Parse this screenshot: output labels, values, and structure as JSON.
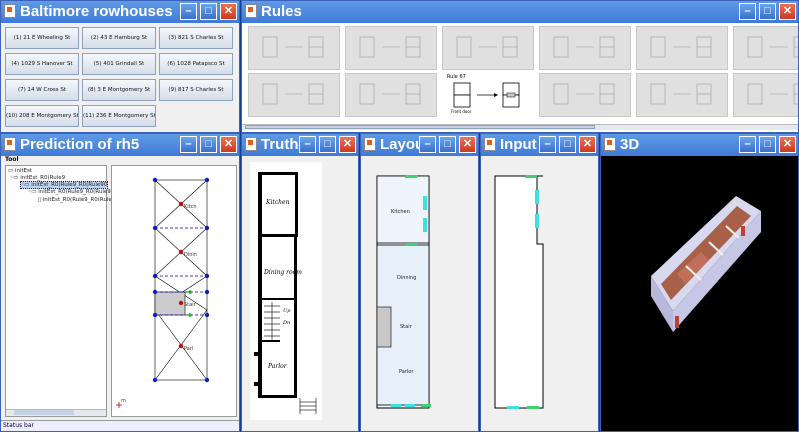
{
  "windows": {
    "baltimore": {
      "title": "Baltimore rowhouses"
    },
    "rules": {
      "title": "Rules"
    },
    "prediction": {
      "title": "Prediction of rh5",
      "menu": "Tool",
      "status": "Status bar"
    },
    "truth": {
      "title": "Truth"
    },
    "layout": {
      "title": "Layout"
    },
    "input": {
      "title": "Input"
    },
    "threed": {
      "title": "3D"
    }
  },
  "rowhouses": [
    "(1) 21 E Wheeling St",
    "(2) 43 E Hamburg St",
    "(3) 821 S Charles St",
    "(4) 1029 S Hanover St",
    "(5) 401 Grindall St",
    "(6) 1028 Patapsco St",
    "(7) 14 W Cross St",
    "(8) 3 E Montgomery St",
    "(9) 817 S Charles St",
    "(10) 208 E Montgomery St",
    "(11) 236 E Montgomery St"
  ],
  "tree": {
    "root": "initEst",
    "n1": "initEst_R0(Rule9",
    "n2": "initEst_R0(Rule9_R0(Rule90",
    "n3": "initEst_R0(Rule9_R0(Rule96_R0(Rule",
    "n4": "initEst_R0(Rule9_R0(Rule96_R0(Ru"
  },
  "rule_detail": {
    "title": "Rule 67",
    "front": "Front door"
  },
  "floorplan": {
    "kitchen": "Kitchen",
    "dining": "Dining room",
    "up": "Up",
    "dn": "Dn",
    "parlor": "Parlor"
  },
  "layout_rooms": {
    "kitchen": "Kitchen",
    "dining": "Dinning",
    "stair": "Stair",
    "parlor": "Parlor"
  },
  "prediction_labels": {
    "a": "Kitch",
    "b": "Dinin",
    "c": "Stair",
    "d": "Parl",
    "origin": "m"
  },
  "colors": {
    "titlebar": "#3f7bd6",
    "desktop": "#1a3f8f",
    "window_green": "#40d070",
    "window_cyan": "#40e0e0"
  }
}
